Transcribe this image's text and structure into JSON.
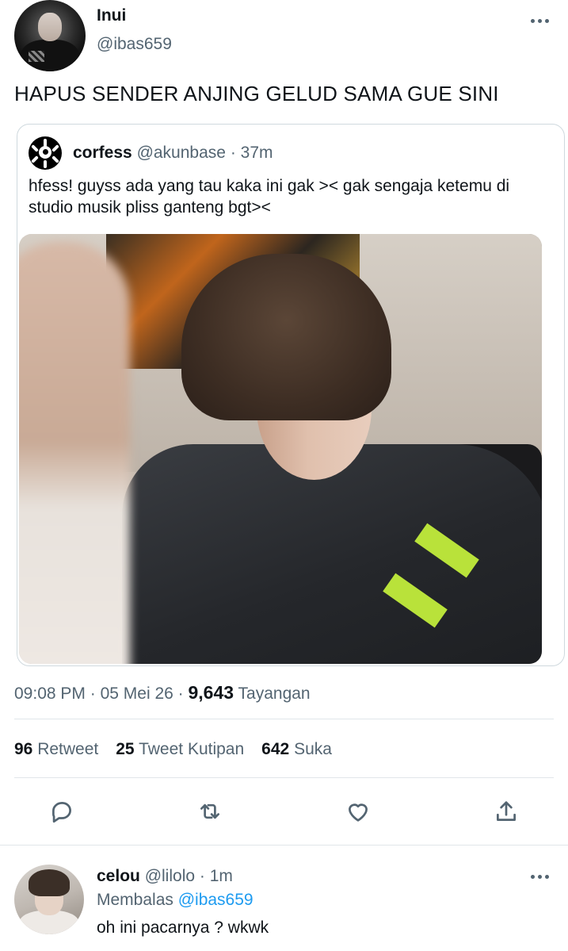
{
  "main_tweet": {
    "display_name": "Inui",
    "handle": "@ibas659",
    "text": "HAPUS SENDER ANJING GELUD SAMA GUE SINI",
    "time": "09:08 PM",
    "separator": "·",
    "date": "05 Mei 26",
    "views_count": "9,643",
    "views_label": "Tayangan"
  },
  "quoted_tweet": {
    "display_name": "corfess",
    "handle": "@akunbase",
    "separator": "·",
    "age": "37m",
    "text": "hfess! guyss ada yang tau kaka ini gak >< gak sengaja ketemu di studio musik pliss ganteng bgt><"
  },
  "stats": {
    "retweets_count": "96",
    "retweets_label": "Retweet",
    "quotes_count": "25",
    "quotes_label": "Tweet Kutipan",
    "likes_count": "642",
    "likes_label": "Suka"
  },
  "actions": [
    "reply-icon",
    "retweet-icon",
    "like-icon",
    "share-icon"
  ],
  "reply": {
    "display_name": "celou",
    "handle": "@lilolo",
    "separator": "·",
    "age": "1m",
    "replying_label": "Membalas",
    "replying_to": "@ibas659",
    "text": "oh ini pacarnya ? wkwk"
  },
  "colors": {
    "text": "#0f1419",
    "secondary": "#536471",
    "link": "#1d9bf0",
    "border": "#cfd9de"
  }
}
